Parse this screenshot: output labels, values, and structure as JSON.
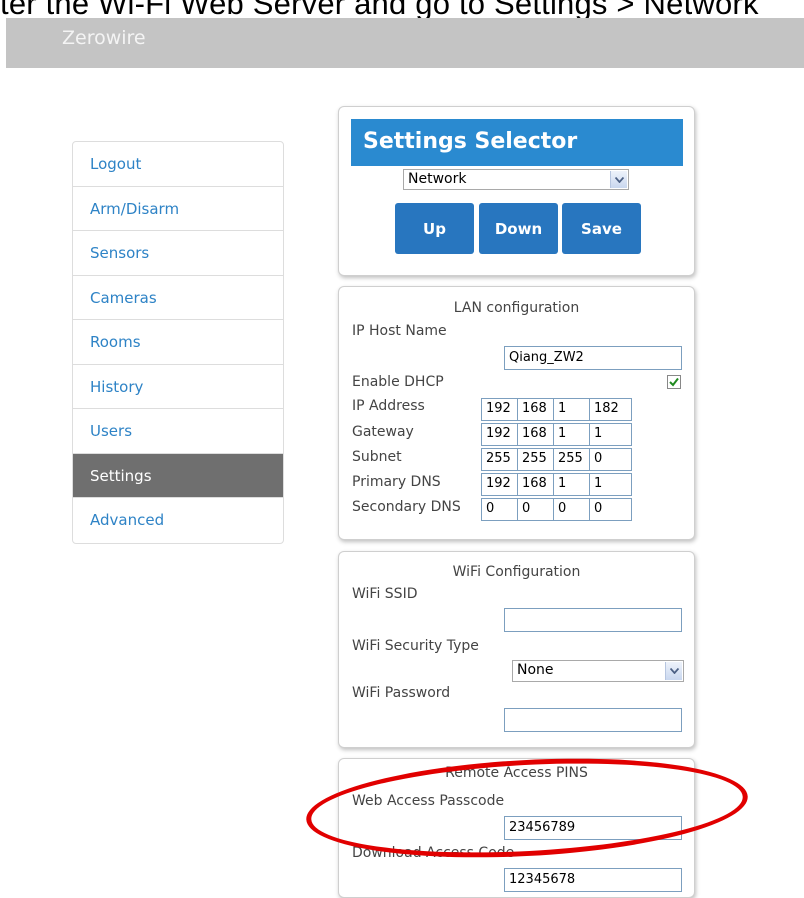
{
  "caption": "ter the Wi-Fi Web Server and go to Settings > Network",
  "app": {
    "brand": "Zerowire"
  },
  "sidebar": {
    "items": [
      {
        "label": "Logout",
        "active": false
      },
      {
        "label": "Arm/Disarm",
        "active": false
      },
      {
        "label": "Sensors",
        "active": false
      },
      {
        "label": "Cameras",
        "active": false
      },
      {
        "label": "Rooms",
        "active": false
      },
      {
        "label": "History",
        "active": false
      },
      {
        "label": "Users",
        "active": false
      },
      {
        "label": "Settings",
        "active": true
      },
      {
        "label": "Advanced",
        "active": false
      }
    ]
  },
  "settings_selector": {
    "title": "Settings Selector",
    "selected": "Network",
    "buttons": {
      "up": "Up",
      "down": "Down",
      "save": "Save"
    }
  },
  "lan": {
    "title": "LAN configuration",
    "host_name_label": "IP Host Name",
    "host_name_value": "Qiang_ZW2",
    "dhcp_label": "Enable DHCP",
    "dhcp_checked": true,
    "ip_label": "IP Address",
    "ip": [
      "192",
      "168",
      "1",
      "182"
    ],
    "gateway_label": "Gateway",
    "gateway": [
      "192",
      "168",
      "1",
      "1"
    ],
    "subnet_label": "Subnet",
    "subnet": [
      "255",
      "255",
      "255",
      "0"
    ],
    "dns1_label": "Primary DNS",
    "dns1": [
      "192",
      "168",
      "1",
      "1"
    ],
    "dns2_label": "Secondary DNS",
    "dns2": [
      "0",
      "0",
      "0",
      "0"
    ]
  },
  "wifi": {
    "title": "WiFi Configuration",
    "ssid_label": "WiFi SSID",
    "ssid_value": "",
    "security_label": "WiFi Security Type",
    "security_value": "None",
    "password_label": "WiFi Password",
    "password_value": ""
  },
  "pins": {
    "title": "Remote Access PINS",
    "web_label": "Web Access Passcode",
    "web_value": "23456789",
    "download_label": "Download Access Code",
    "download_value": "12345678"
  },
  "colors": {
    "accent": "#2a8ad0",
    "button": "#2876bf",
    "nav_link": "#2e83c6",
    "nav_active": "#6f6f6f",
    "annotation": "#e10000"
  }
}
